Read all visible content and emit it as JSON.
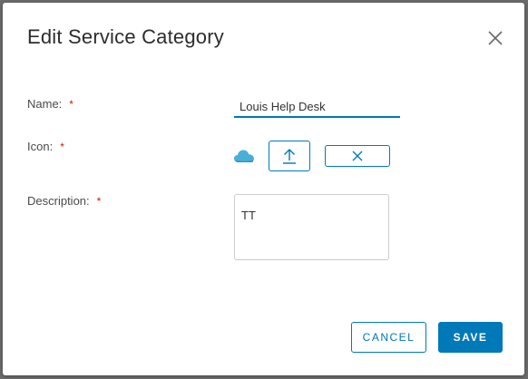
{
  "dialog": {
    "title": "Edit Service Category",
    "close_icon": "close-icon"
  },
  "form": {
    "name_label": "Name:",
    "name_value": "Louis Help Desk",
    "icon_label": "Icon:",
    "icon_preview": "cloud-icon",
    "upload_icon": "upload-arrow-icon",
    "clear_icon": "close-icon",
    "description_label": "Description:",
    "description_value": "TT",
    "required_marker": "*"
  },
  "footer": {
    "cancel_label": "CANCEL",
    "save_label": "SAVE"
  },
  "colors": {
    "accent": "#0079b8",
    "required": "#c92100",
    "cloud": "#49afd9"
  }
}
